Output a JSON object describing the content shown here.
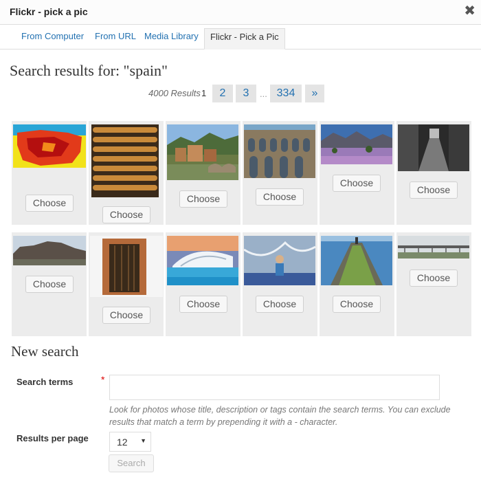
{
  "window": {
    "title": "Flickr - pick a pic",
    "close_glyph": "✖"
  },
  "tabs": [
    {
      "label": "From Computer",
      "active": false
    },
    {
      "label": "From URL",
      "active": false
    },
    {
      "label": "Media Library",
      "active": false
    },
    {
      "label": "Flickr - Pick a Pic",
      "active": true
    }
  ],
  "results": {
    "title": "Search results for: \"spain\"",
    "count_label": "4000 Results",
    "current_page": "1",
    "pages": [
      "2",
      "3",
      "334"
    ],
    "ellipsis": "...",
    "next_label": "»"
  },
  "grid": {
    "choose_label": "Choose",
    "photos": [
      {
        "subject": "map-of-spain-heatmap"
      },
      {
        "subject": "curved-building-balconies"
      },
      {
        "subject": "hilltop-village-bridge"
      },
      {
        "subject": "roman-aqueduct"
      },
      {
        "subject": "purple-field-mountains"
      },
      {
        "subject": "narrow-stone-street-bw"
      },
      {
        "subject": "flat-top-mountain"
      },
      {
        "subject": "old-wooden-doorway"
      },
      {
        "subject": "modern-architecture-valencia"
      },
      {
        "subject": "child-in-fountain"
      },
      {
        "subject": "breakwater-lighthouse"
      },
      {
        "subject": "bridge-over-river"
      }
    ]
  },
  "new_search": {
    "heading": "New search",
    "terms_label": "Search terms",
    "required_mark": "*",
    "terms_value": "",
    "help_text": "Look for photos whose title, description or tags contain the search terms. You can exclude results that match a term by prepending it with a - character.",
    "per_page_label": "Results per page",
    "per_page_value": "12",
    "dropdown_glyph": "▼",
    "search_button": "Search"
  }
}
